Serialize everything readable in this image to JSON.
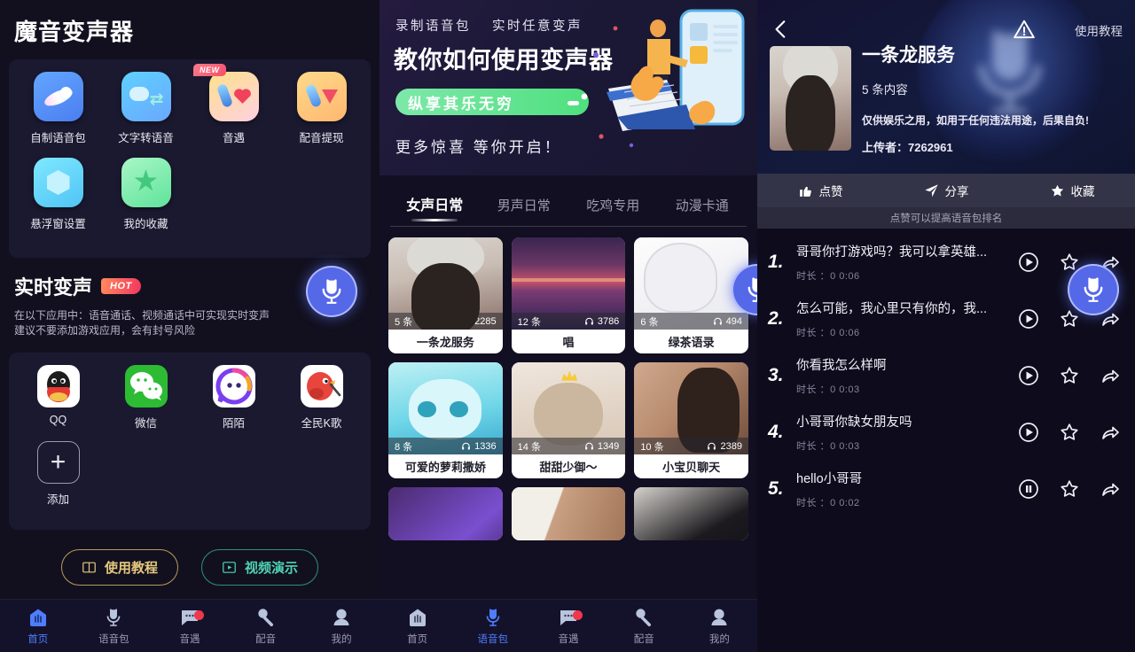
{
  "left": {
    "app_title": "魔音变声器",
    "features": [
      {
        "label": "自制语音包",
        "icon": "satellite-icon",
        "badge": null
      },
      {
        "label": "文字转语音",
        "icon": "text-to-speech-icon",
        "badge": null
      },
      {
        "label": "音遇",
        "icon": "music-heart-icon",
        "badge": "NEW"
      },
      {
        "label": "配音提现",
        "icon": "dubbing-cashout-icon",
        "badge": null
      },
      {
        "label": "悬浮窗设置",
        "icon": "floating-window-icon",
        "badge": null
      },
      {
        "label": "我的收藏",
        "icon": "star-favorite-icon",
        "badge": null
      }
    ],
    "realtime": {
      "title": "实时变声",
      "badge": "HOT",
      "desc_line1": "在以下应用中：语音通话、视频通话中可实现实时变声",
      "desc_line2": "建议不要添加游戏应用，会有封号风险"
    },
    "apps": [
      {
        "label": "QQ",
        "icon": "qq-icon"
      },
      {
        "label": "微信",
        "icon": "wechat-icon"
      },
      {
        "label": "陌陌",
        "icon": "momo-icon"
      },
      {
        "label": "全民K歌",
        "icon": "karaoke-icon"
      },
      {
        "label": "添加",
        "icon": "plus-icon"
      }
    ],
    "buttons": {
      "tutorial": "使用教程",
      "video_demo": "视频演示"
    },
    "nav": [
      {
        "label": "首页",
        "icon": "home-icon",
        "active": true,
        "badge": false
      },
      {
        "label": "语音包",
        "icon": "voice-pack-icon",
        "active": false,
        "badge": false
      },
      {
        "label": "音遇",
        "icon": "chat-icon",
        "active": false,
        "badge": true
      },
      {
        "label": "配音",
        "icon": "dubbing-icon",
        "active": false,
        "badge": false
      },
      {
        "label": "我的",
        "icon": "profile-icon",
        "active": false,
        "badge": false
      }
    ]
  },
  "mid": {
    "banner": {
      "line1_a": "录制语音包",
      "line1_b": "实时任意变声",
      "title": "教你如何使用变声器",
      "ribbon": "纵享其乐无穷",
      "line3": "更多惊喜  等你开启！"
    },
    "tabs": [
      {
        "label": "女声日常",
        "active": true
      },
      {
        "label": "男声日常",
        "active": false
      },
      {
        "label": "吃鸡专用",
        "active": false
      },
      {
        "label": "动漫卡通",
        "active": false
      }
    ],
    "cards": [
      {
        "name": "一条龙服务",
        "count": "5 条",
        "plays": "2285",
        "art": "img-girl1"
      },
      {
        "name": "唱",
        "count": "12 条",
        "plays": "3786",
        "art": "img-sunset"
      },
      {
        "name": "绿茶语录",
        "count": "6 条",
        "plays": "494",
        "art": "img-anime-w"
      },
      {
        "name": "可爱的萝莉撒娇",
        "count": "8 条",
        "plays": "1336",
        "art": "img-anime-b"
      },
      {
        "name": "甜甜少御～",
        "count": "14 条",
        "plays": "1349",
        "art": "img-cat"
      },
      {
        "name": "小宝贝聊天",
        "count": "10 条",
        "plays": "2389",
        "art": "img-girl2"
      }
    ],
    "cards_row3": [
      {
        "art": "img-dark1"
      },
      {
        "art": "img-face1"
      },
      {
        "art": "img-eye"
      }
    ],
    "nav": [
      {
        "label": "首页",
        "icon": "home-icon",
        "active": false,
        "badge": false
      },
      {
        "label": "语音包",
        "icon": "voice-pack-icon",
        "active": true,
        "badge": false
      },
      {
        "label": "音遇",
        "icon": "chat-icon",
        "active": false,
        "badge": true
      },
      {
        "label": "配音",
        "icon": "dubbing-icon",
        "active": false,
        "badge": false
      },
      {
        "label": "我的",
        "icon": "profile-icon",
        "active": false,
        "badge": false
      }
    ]
  },
  "right": {
    "tutorial_link": "使用教程",
    "pack_title": "一条龙服务",
    "pack_count": "5 条内容",
    "disclaimer": "仅供娱乐之用，如用于任何违法用途，后果自负!",
    "uploader": "上传者：7262961",
    "actions": [
      {
        "label": "点赞",
        "icon": "thumbs-up-icon"
      },
      {
        "label": "分享",
        "icon": "share-icon"
      },
      {
        "label": "收藏",
        "icon": "star-icon"
      }
    ],
    "tip": "点赞可以提高语音包排名",
    "duration_label": "时长 ：",
    "items": [
      {
        "index": "1.",
        "name": "哥哥你打游戏吗？我可以拿英雄...",
        "duration": "0 0:06",
        "state": "play"
      },
      {
        "index": "2.",
        "name": "怎么可能，我心里只有你的，我...",
        "duration": "0 0:06",
        "state": "play"
      },
      {
        "index": "3.",
        "name": "你看我怎么样啊",
        "duration": "0 0:03",
        "state": "play"
      },
      {
        "index": "4.",
        "name": "小哥哥你缺女朋友吗",
        "duration": "0 0:03",
        "state": "play"
      },
      {
        "index": "5.",
        "name": "hello小哥哥",
        "duration": "0 0:02",
        "state": "pause"
      }
    ]
  },
  "colors": {
    "accent_blue": "#4f7dff",
    "mic_blue": "#5568e8",
    "hot_red": "#f2365f",
    "gold": "#e6c97e",
    "teal": "#4fd5b4",
    "badge_red": "#f0374b"
  }
}
